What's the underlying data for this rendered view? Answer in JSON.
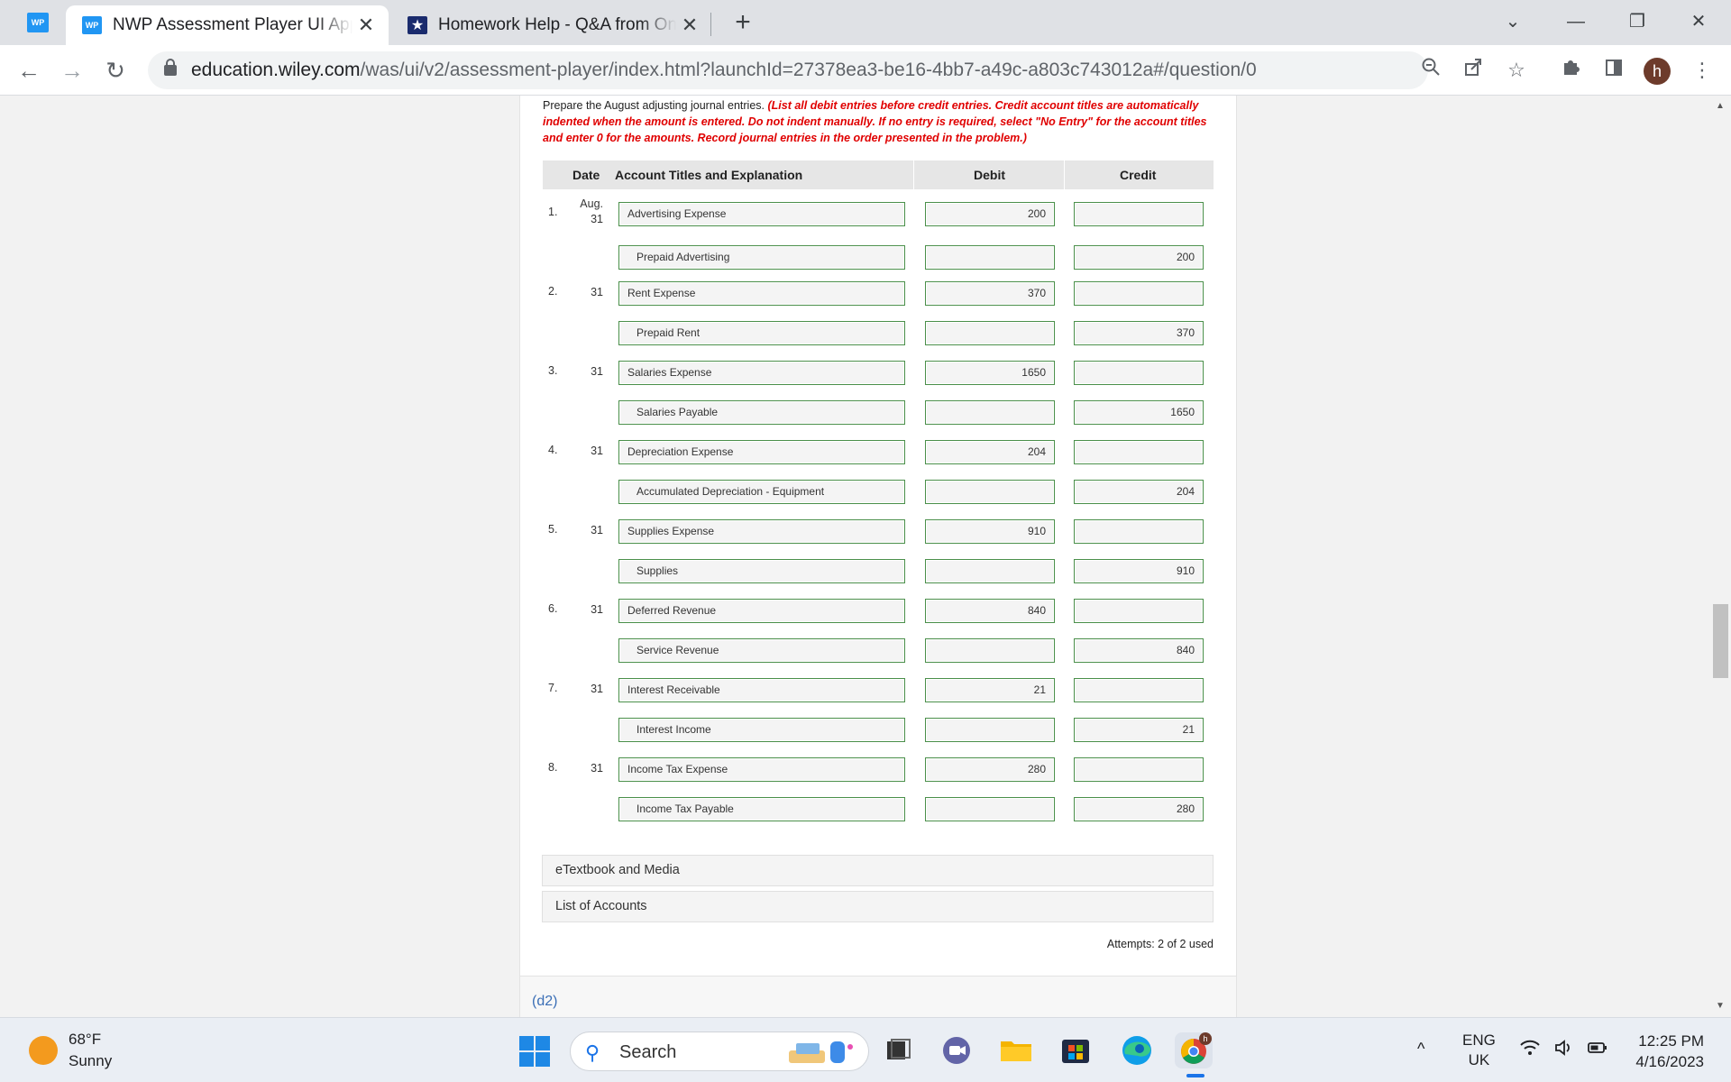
{
  "browser": {
    "tabs": [
      {
        "favicon": "WP",
        "title": "NWP Assessment Player UI Application",
        "active": true
      },
      {
        "favicon": "★",
        "title": "Homework Help - Q&A from Online Tutors",
        "active": false
      }
    ],
    "mini_favicon": "WP",
    "close_glyph": "✕",
    "new_tab_glyph": "+",
    "window_controls": {
      "chevron": "⌄",
      "minimize": "—",
      "restore": "❐",
      "close": "✕"
    },
    "nav": {
      "back": "←",
      "forward": "→",
      "reload": "↻"
    },
    "url_host": "education.wiley.com",
    "url_path": "/was/ui/v2/assessment-player/index.html?launchId=27378ea3-be16-4bb7-a49c-a803c743012a#/question/0",
    "toolbar_icons": {
      "zoom": "zoom-out-icon",
      "share": "share-icon",
      "bookmark": "star-icon",
      "extensions": "puzzle-icon",
      "side_panel": "side-panel-icon",
      "menu": "kebab-menu-icon"
    },
    "profile_initial": "h"
  },
  "question": {
    "instruction_plain": "Prepare the August adjusting journal entries.",
    "instruction_red": "(List all debit entries before credit entries. Credit account titles are automatically indented when the amount is entered. Do not indent manually. If no entry is required, select \"No Entry\" for the account titles and enter 0 for the amounts. Record journal entries in the order presented in the problem.)",
    "headers": {
      "date": "Date",
      "account": "Account Titles and Explanation",
      "debit": "Debit",
      "credit": "Credit"
    },
    "entries": [
      {
        "num": "1.",
        "date_month": "Aug.",
        "date_day": "31",
        "debit_account": "Advertising Expense",
        "debit": "200",
        "credit_account": "Prepaid Advertising",
        "credit": "200"
      },
      {
        "num": "2.",
        "date_month": "",
        "date_day": "31",
        "debit_account": "Rent Expense",
        "debit": "370",
        "credit_account": "Prepaid Rent",
        "credit": "370"
      },
      {
        "num": "3.",
        "date_month": "",
        "date_day": "31",
        "debit_account": "Salaries Expense",
        "debit": "1650",
        "credit_account": "Salaries Payable",
        "credit": "1650"
      },
      {
        "num": "4.",
        "date_month": "",
        "date_day": "31",
        "debit_account": "Depreciation Expense",
        "debit": "204",
        "credit_account": "Accumulated Depreciation - Equipment",
        "credit": "204"
      },
      {
        "num": "5.",
        "date_month": "",
        "date_day": "31",
        "debit_account": "Supplies Expense",
        "debit": "910",
        "credit_account": "Supplies",
        "credit": "910"
      },
      {
        "num": "6.",
        "date_month": "",
        "date_day": "31",
        "debit_account": "Deferred Revenue",
        "debit": "840",
        "credit_account": "Service Revenue",
        "credit": "840"
      },
      {
        "num": "7.",
        "date_month": "",
        "date_day": "31",
        "debit_account": "Interest Receivable",
        "debit": "21",
        "credit_account": "Interest Income",
        "credit": "21"
      },
      {
        "num": "8.",
        "date_month": "",
        "date_day": "31",
        "debit_account": "Income Tax Expense",
        "debit": "280",
        "credit_account": "Income Tax Payable",
        "credit": "280"
      }
    ],
    "accordions": [
      "eTextbook and Media",
      "List of Accounts"
    ],
    "attempts": "Attempts: 2 of 2 used",
    "next_part": "(d2)"
  },
  "taskbar": {
    "weather_temp": "68°F",
    "weather_desc": "Sunny",
    "search_label": "Search",
    "tray_caret": "^",
    "lang_line1": "ENG",
    "lang_line2": "UK",
    "time": "12:25 PM",
    "date": "4/16/2023",
    "apps": [
      "file-explorer-icon",
      "teams-chat-icon",
      "folder-icon",
      "microsoft-store-icon",
      "edge-icon",
      "chrome-icon"
    ]
  },
  "colors": {
    "accent": "#2196f3",
    "field_border": "#4a8f4a",
    "instruction_red": "#e00000",
    "link_blue": "#3b6fb6"
  }
}
